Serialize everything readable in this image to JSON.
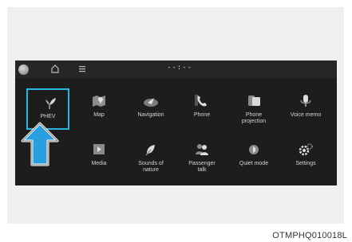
{
  "statusbar": {
    "time": "--:--",
    "home_icon": "home-icon",
    "menu_icon": "menu-icon"
  },
  "apps": {
    "row1": [
      {
        "label": "PHEV",
        "icon": "leaf-icon",
        "selected": true
      },
      {
        "label": "Map",
        "icon": "map-icon"
      },
      {
        "label": "Navigation",
        "icon": "navigation-icon"
      },
      {
        "label": "Phone",
        "icon": "phone-icon"
      },
      {
        "label": "Phone\nprojection",
        "icon": "phone-projection-icon"
      },
      {
        "label": "Voice memo",
        "icon": "voice-memo-icon"
      }
    ],
    "row2": [
      {
        "label": "Media",
        "icon": "media-icon"
      },
      {
        "label": "Sounds of\nnature",
        "icon": "sounds-of-nature-icon"
      },
      {
        "label": "Passenger\ntalk",
        "icon": "passenger-talk-icon"
      },
      {
        "label": "Quiet mode",
        "icon": "quiet-mode-icon"
      },
      {
        "label": "Settings",
        "icon": "settings-icon"
      }
    ]
  },
  "colors": {
    "screen_bg": "#1d1d1d",
    "highlight": "#29b6e6",
    "arrow_fill": "#2a9fe0"
  },
  "caption": "OTMPHQ010018L"
}
